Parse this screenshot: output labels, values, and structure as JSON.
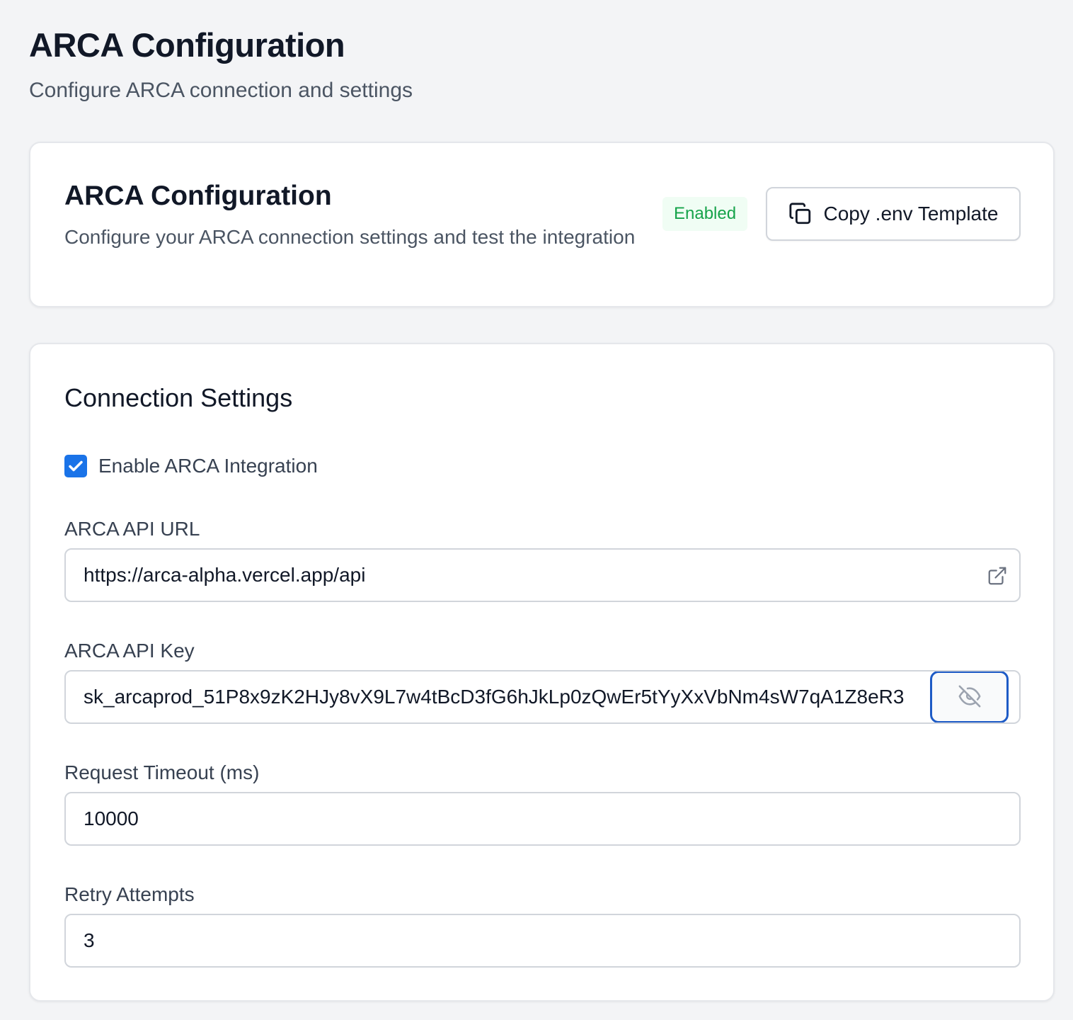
{
  "page": {
    "title": "ARCA Configuration",
    "subtitle": "Configure ARCA connection and settings"
  },
  "header_card": {
    "title": "ARCA Configuration",
    "description": "Configure your ARCA connection settings and test the integration",
    "status_badge": "Enabled",
    "copy_button_label": "Copy .env Template"
  },
  "connection_settings": {
    "title": "Connection Settings",
    "enable_checkbox": {
      "label": "Enable ARCA Integration",
      "checked": true
    },
    "api_url": {
      "label": "ARCA API URL",
      "value": "https://arca-alpha.vercel.app/api"
    },
    "api_key": {
      "label": "ARCA API Key",
      "value": "sk_arcaprod_51P8x9zK2HJy8vX9L7w4tBcD3fG6hJkLp0zQwEr5tYyXxVbNm4sW7qA1Z8eR3"
    },
    "timeout": {
      "label": "Request Timeout (ms)",
      "value": "10000"
    },
    "retry": {
      "label": "Retry Attempts",
      "value": "3"
    }
  },
  "icons": {
    "copy": "copy-icon",
    "external_link": "external-link-icon",
    "eye_off": "eye-off-icon",
    "check": "check-icon"
  },
  "colors": {
    "accent": "#1a73e8",
    "focus_ring": "#1e5bc6",
    "status_green": "#16a34a",
    "status_green_bg": "#f0fdf4"
  }
}
